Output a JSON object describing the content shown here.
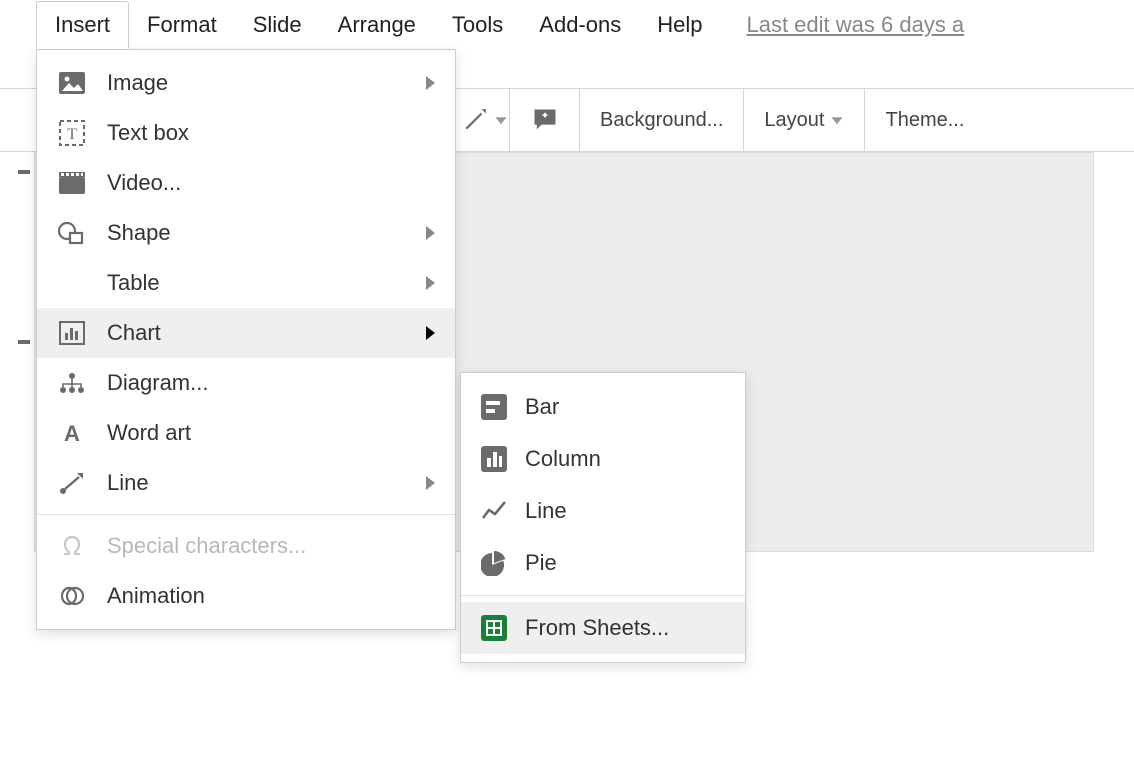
{
  "menubar": {
    "items": [
      "Insert",
      "Format",
      "Slide",
      "Arrange",
      "Tools",
      "Add-ons",
      "Help"
    ],
    "active_index": 0,
    "last_edit": "Last edit was 6 days a"
  },
  "toolbar": {
    "background": "Background...",
    "layout": "Layout",
    "theme": "Theme..."
  },
  "insert_menu": {
    "items": [
      {
        "icon": "image-icon",
        "label": "Image",
        "submenu": true
      },
      {
        "icon": "textbox-icon",
        "label": "Text box",
        "submenu": false
      },
      {
        "icon": "video-icon",
        "label": "Video...",
        "submenu": false
      },
      {
        "icon": "shape-icon",
        "label": "Shape",
        "submenu": true
      },
      {
        "icon": null,
        "label": "Table",
        "submenu": true
      },
      {
        "icon": "chart-icon",
        "label": "Chart",
        "submenu": true,
        "highlight": true
      },
      {
        "icon": "diagram-icon",
        "label": "Diagram...",
        "submenu": false
      },
      {
        "icon": "wordart-icon",
        "label": "Word art",
        "submenu": false
      },
      {
        "icon": "line-icon",
        "label": "Line",
        "submenu": true
      },
      {
        "divider": true
      },
      {
        "icon": "omega-icon",
        "label": "Special characters...",
        "submenu": false,
        "disabled": true
      },
      {
        "icon": "animation-icon",
        "label": "Animation",
        "submenu": false
      }
    ]
  },
  "chart_submenu": {
    "items": [
      {
        "icon": "bar-icon",
        "label": "Bar"
      },
      {
        "icon": "column-icon",
        "label": "Column"
      },
      {
        "icon": "linechart-icon",
        "label": "Line"
      },
      {
        "icon": "pie-icon",
        "label": "Pie"
      },
      {
        "divider": true
      },
      {
        "icon": "sheets-icon",
        "label": "From Sheets...",
        "highlight": true
      }
    ]
  },
  "colors": {
    "icon_gray": "#6b6b6b",
    "sheets_green": "#188038",
    "disabled": "#b8b8b8"
  }
}
